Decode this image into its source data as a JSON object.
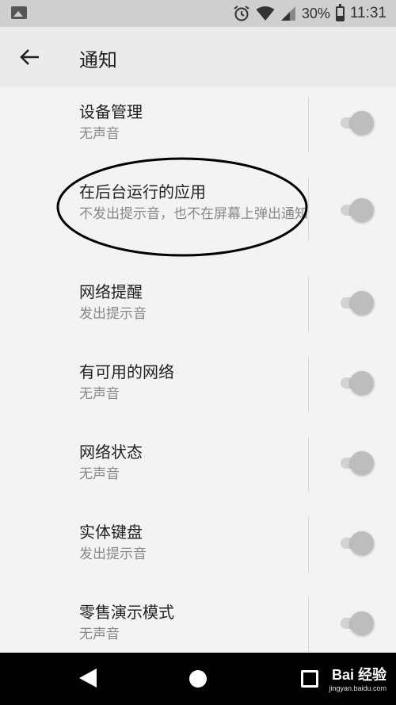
{
  "status_bar": {
    "battery_percent": "30%",
    "time": "11:31",
    "icons": [
      "gallery-icon",
      "alarm-icon",
      "wifi-icon",
      "signal-icon",
      "battery-icon"
    ]
  },
  "app_bar": {
    "title": "通知",
    "back_icon": "arrow-left-icon"
  },
  "settings": [
    {
      "title": "设备管理",
      "subtitle": "无声音",
      "enabled": false
    },
    {
      "title": "在后台运行的应用",
      "subtitle": "不发出提示音，也不在屏幕上弹出通知",
      "enabled": false
    },
    {
      "title": "网络提醒",
      "subtitle": "发出提示音",
      "enabled": false
    },
    {
      "title": "有可用的网络",
      "subtitle": "无声音",
      "enabled": false
    },
    {
      "title": "网络状态",
      "subtitle": "无声音",
      "enabled": false
    },
    {
      "title": "实体键盘",
      "subtitle": "发出提示音",
      "enabled": false
    },
    {
      "title": "零售演示模式",
      "subtitle": "无声音",
      "enabled": false
    }
  ],
  "nav_bar": {
    "icons": [
      "nav-back-icon",
      "nav-home-icon",
      "nav-recent-icon"
    ],
    "watermark_brand": "Bai 经验",
    "watermark_url": "jingyan.baidu.com"
  },
  "colors": {
    "status_bar": "#cfcfcf",
    "app_bar": "#ebebeb",
    "background": "#f3f3f3",
    "nav_bar": "#000000",
    "toggle_off_thumb": "#bdbdbd"
  }
}
